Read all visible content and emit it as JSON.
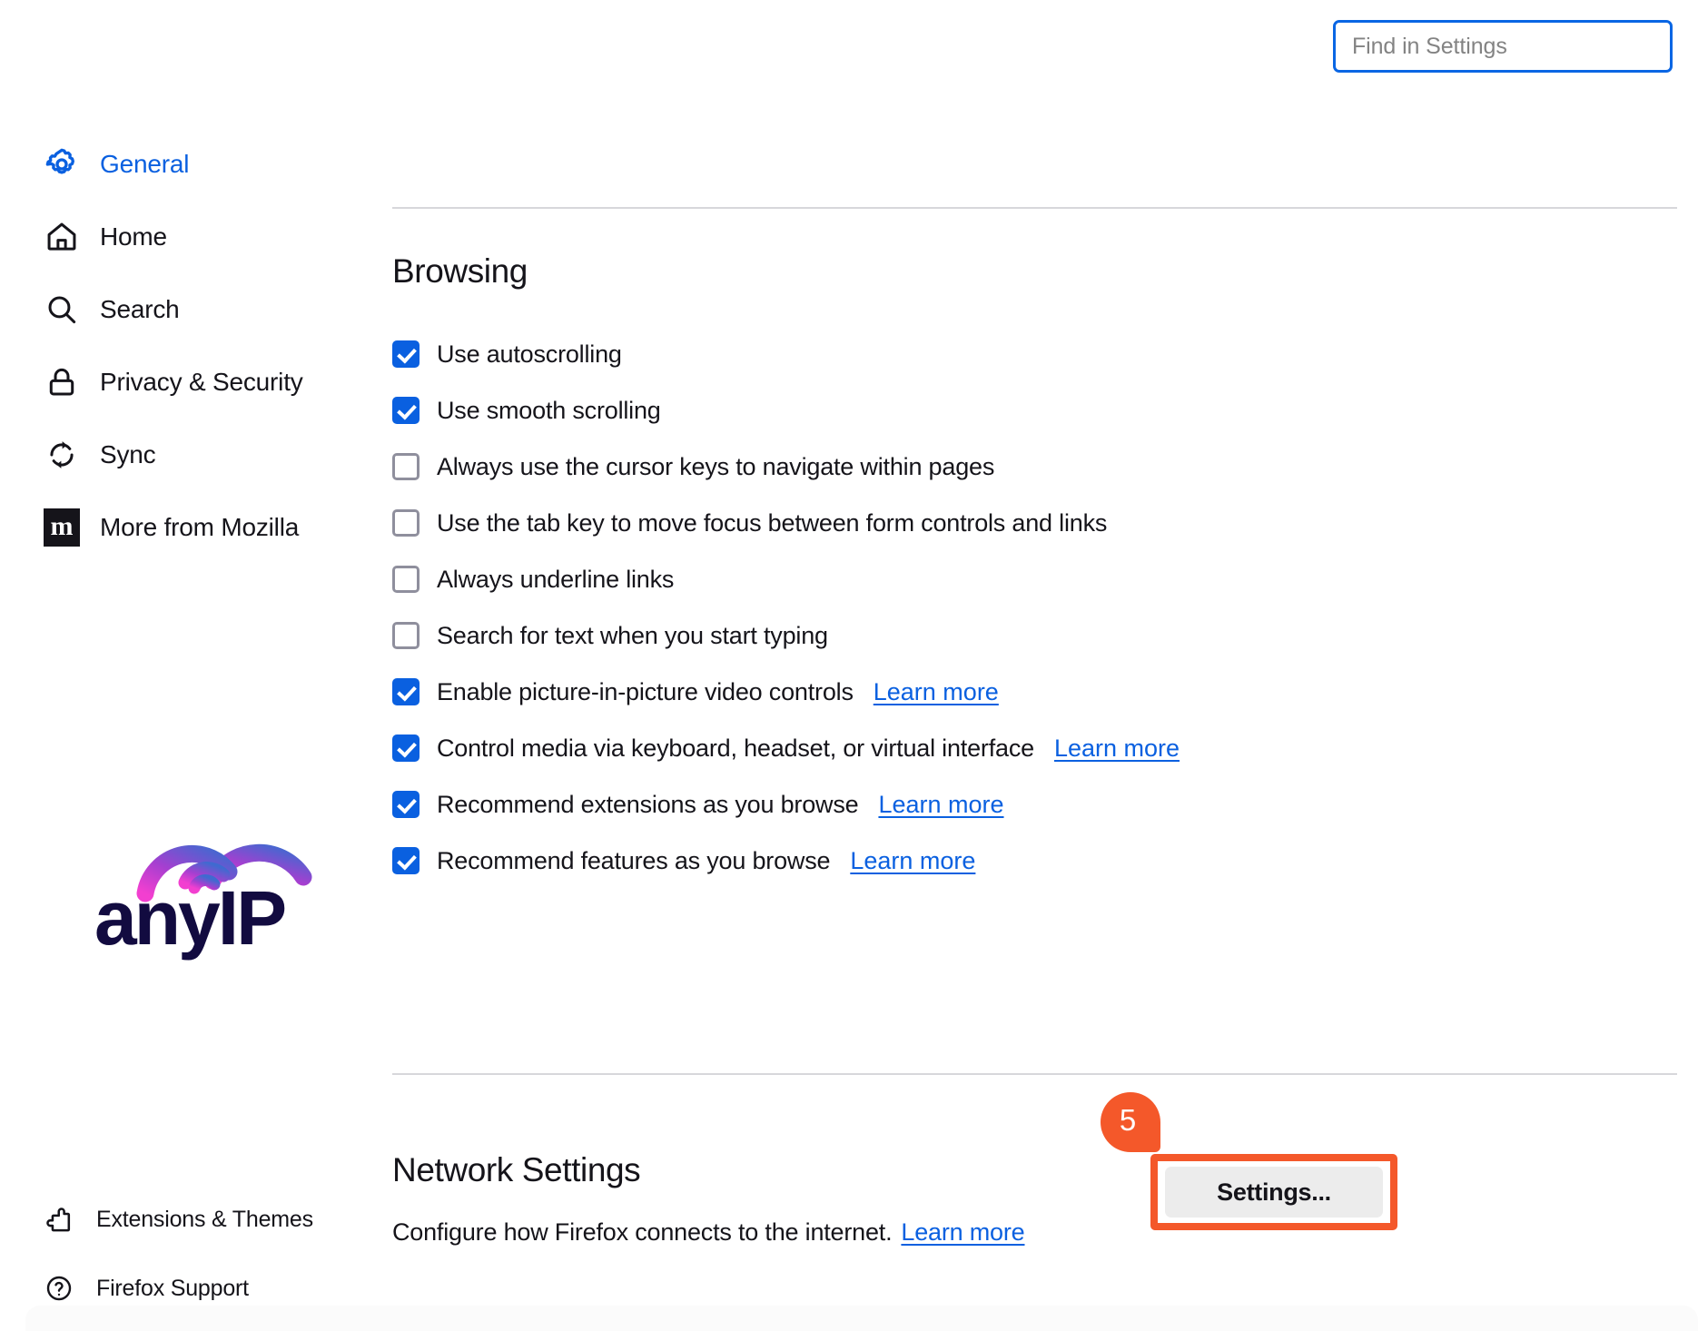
{
  "search": {
    "placeholder": "Find in Settings",
    "name": "find-in-settings"
  },
  "sidebar": {
    "primary_items": [
      {
        "label": "General",
        "icon": "gear-icon",
        "active": true
      },
      {
        "label": "Home",
        "icon": "home-icon",
        "active": false
      },
      {
        "label": "Search",
        "icon": "search-icon",
        "active": false
      },
      {
        "label": "Privacy & Security",
        "icon": "lock-icon",
        "active": false
      },
      {
        "label": "Sync",
        "icon": "sync-icon",
        "active": false
      },
      {
        "label": "More from Mozilla",
        "icon": "mozilla-m-icon",
        "active": false
      }
    ],
    "mozilla_glyph": "m",
    "footer_items": [
      {
        "label": "Extensions & Themes",
        "icon": "puzzle-piece-icon"
      },
      {
        "label": "Firefox Support",
        "icon": "question-circle-icon"
      }
    ],
    "logo": {
      "name": "anyip-logo",
      "text": "anyIP",
      "text_color": "#120b40",
      "gradient_start": "#f23fd0",
      "gradient_mid": "#8b3fd0",
      "gradient_end": "#3f6ad0"
    }
  },
  "main": {
    "browsing": {
      "title": "Browsing",
      "options": [
        {
          "label": "Use autoscrolling",
          "checked": true,
          "learn_more": null
        },
        {
          "label": "Use smooth scrolling",
          "checked": true,
          "learn_more": null
        },
        {
          "label": "Always use the cursor keys to navigate within pages",
          "checked": false,
          "learn_more": null
        },
        {
          "label": "Use the tab key to move focus between form controls and links",
          "checked": false,
          "learn_more": null
        },
        {
          "label": "Always underline links",
          "checked": false,
          "learn_more": null
        },
        {
          "label": "Search for text when you start typing",
          "checked": false,
          "learn_more": null
        },
        {
          "label": "Enable picture-in-picture video controls",
          "checked": true,
          "learn_more": "Learn more"
        },
        {
          "label": "Control media via keyboard, headset, or virtual interface",
          "checked": true,
          "learn_more": "Learn more"
        },
        {
          "label": "Recommend extensions as you browse",
          "checked": true,
          "learn_more": "Learn more"
        },
        {
          "label": "Recommend features as you browse",
          "checked": true,
          "learn_more": "Learn more"
        }
      ]
    },
    "network": {
      "title": "Network Settings",
      "description": "Configure how Firefox connects to the internet.",
      "learn_more": "Learn more",
      "settings_button": "Settings...",
      "badge_number": "5",
      "highlight_color": "#f4582a"
    }
  },
  "colors": {
    "accent_blue": "#0a60e0",
    "link_blue": "#0a60e0",
    "text": "#15141a",
    "checkbox_off_border": "#8f8f9d",
    "divider": "#d7d7db",
    "button_bg": "#ececec"
  }
}
